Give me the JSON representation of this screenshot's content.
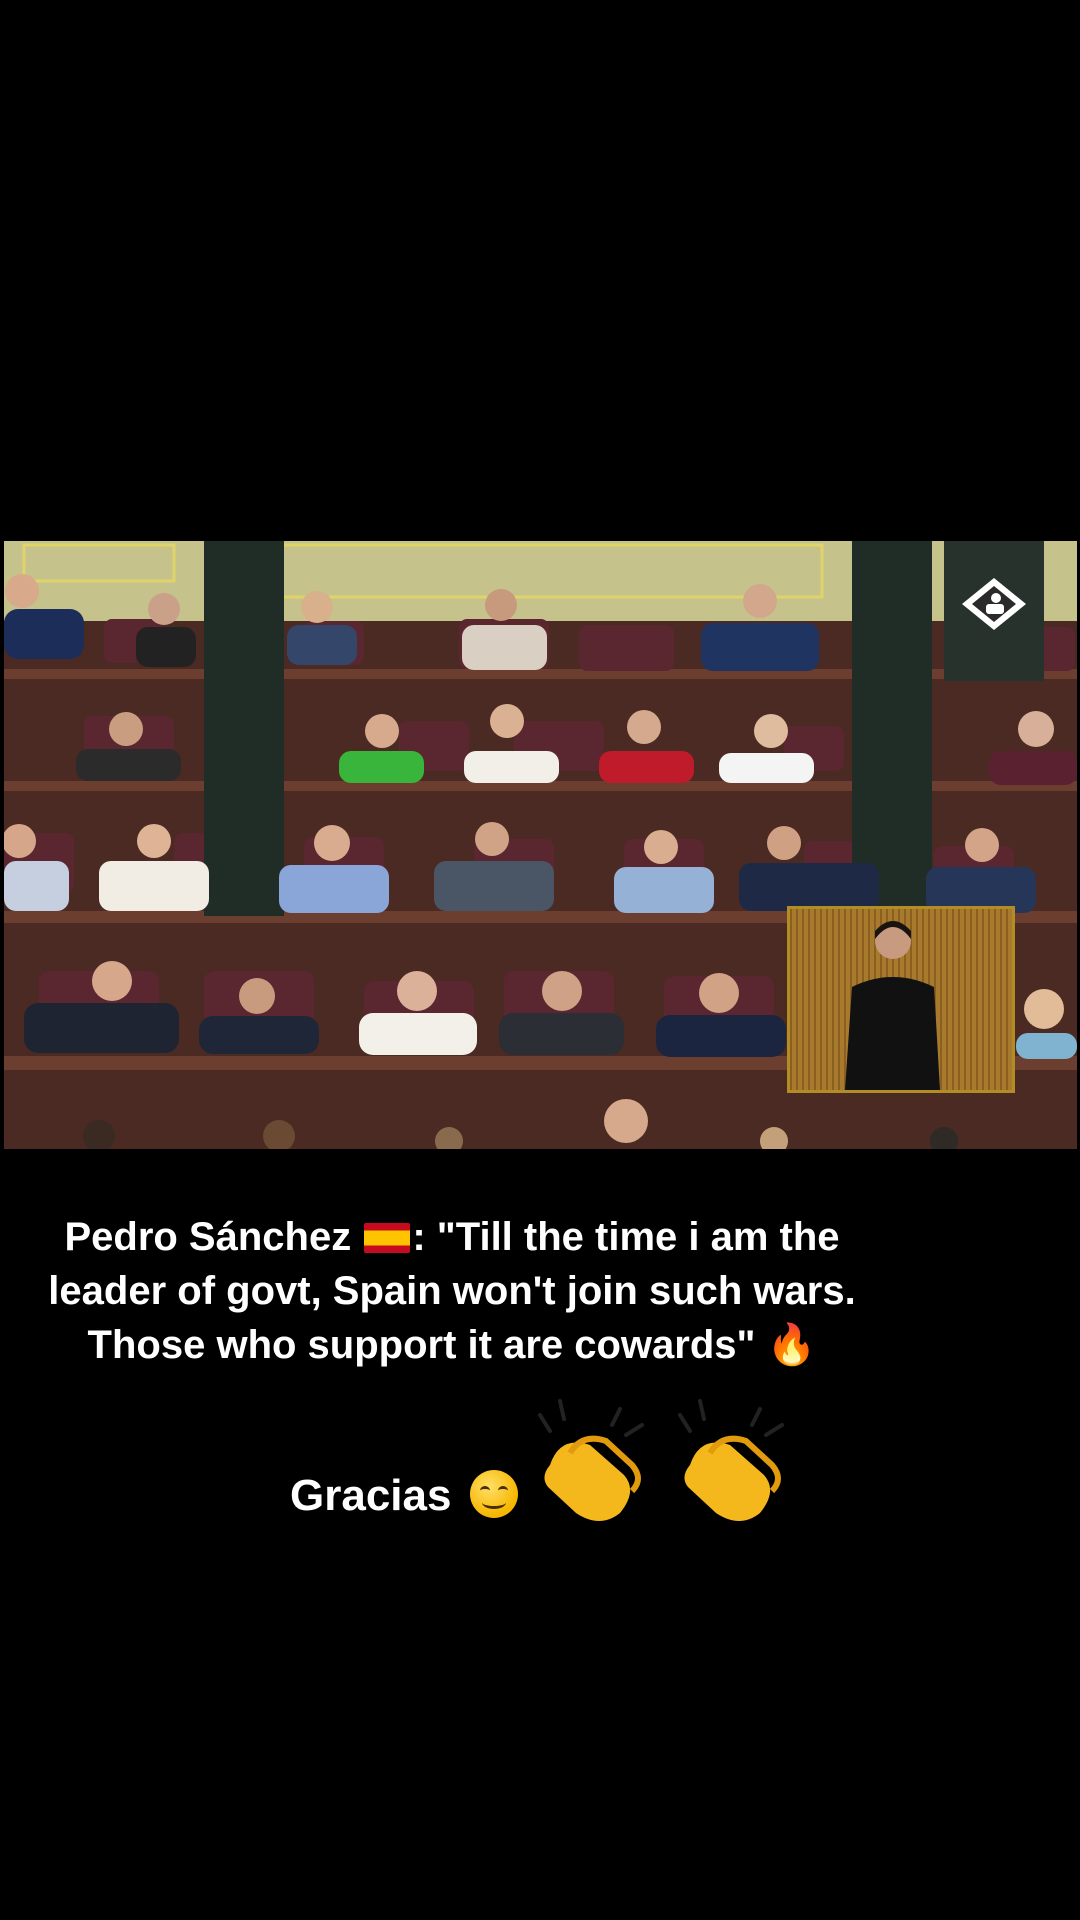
{
  "video": {
    "description_tag": "parliament-chamber-footage",
    "accent_colors": {
      "bench": "#5b2e27",
      "wall": "#c9c98f",
      "column": "#1d2b24",
      "inset_border": "#b28c24"
    }
  },
  "caption": {
    "speaker": "Pedro Sánchez",
    "line1_rest": ": \"Till the time i am the",
    "line2": "leader of govt, Spain won't join such wars.",
    "line3": "Those who support it are cowards\"",
    "thanks": "Gracias"
  },
  "icons": [
    "spain-flag-icon",
    "fire-icon",
    "clapping-hands-icon",
    "smiling-face-icon",
    "sign-language-logo-icon"
  ]
}
